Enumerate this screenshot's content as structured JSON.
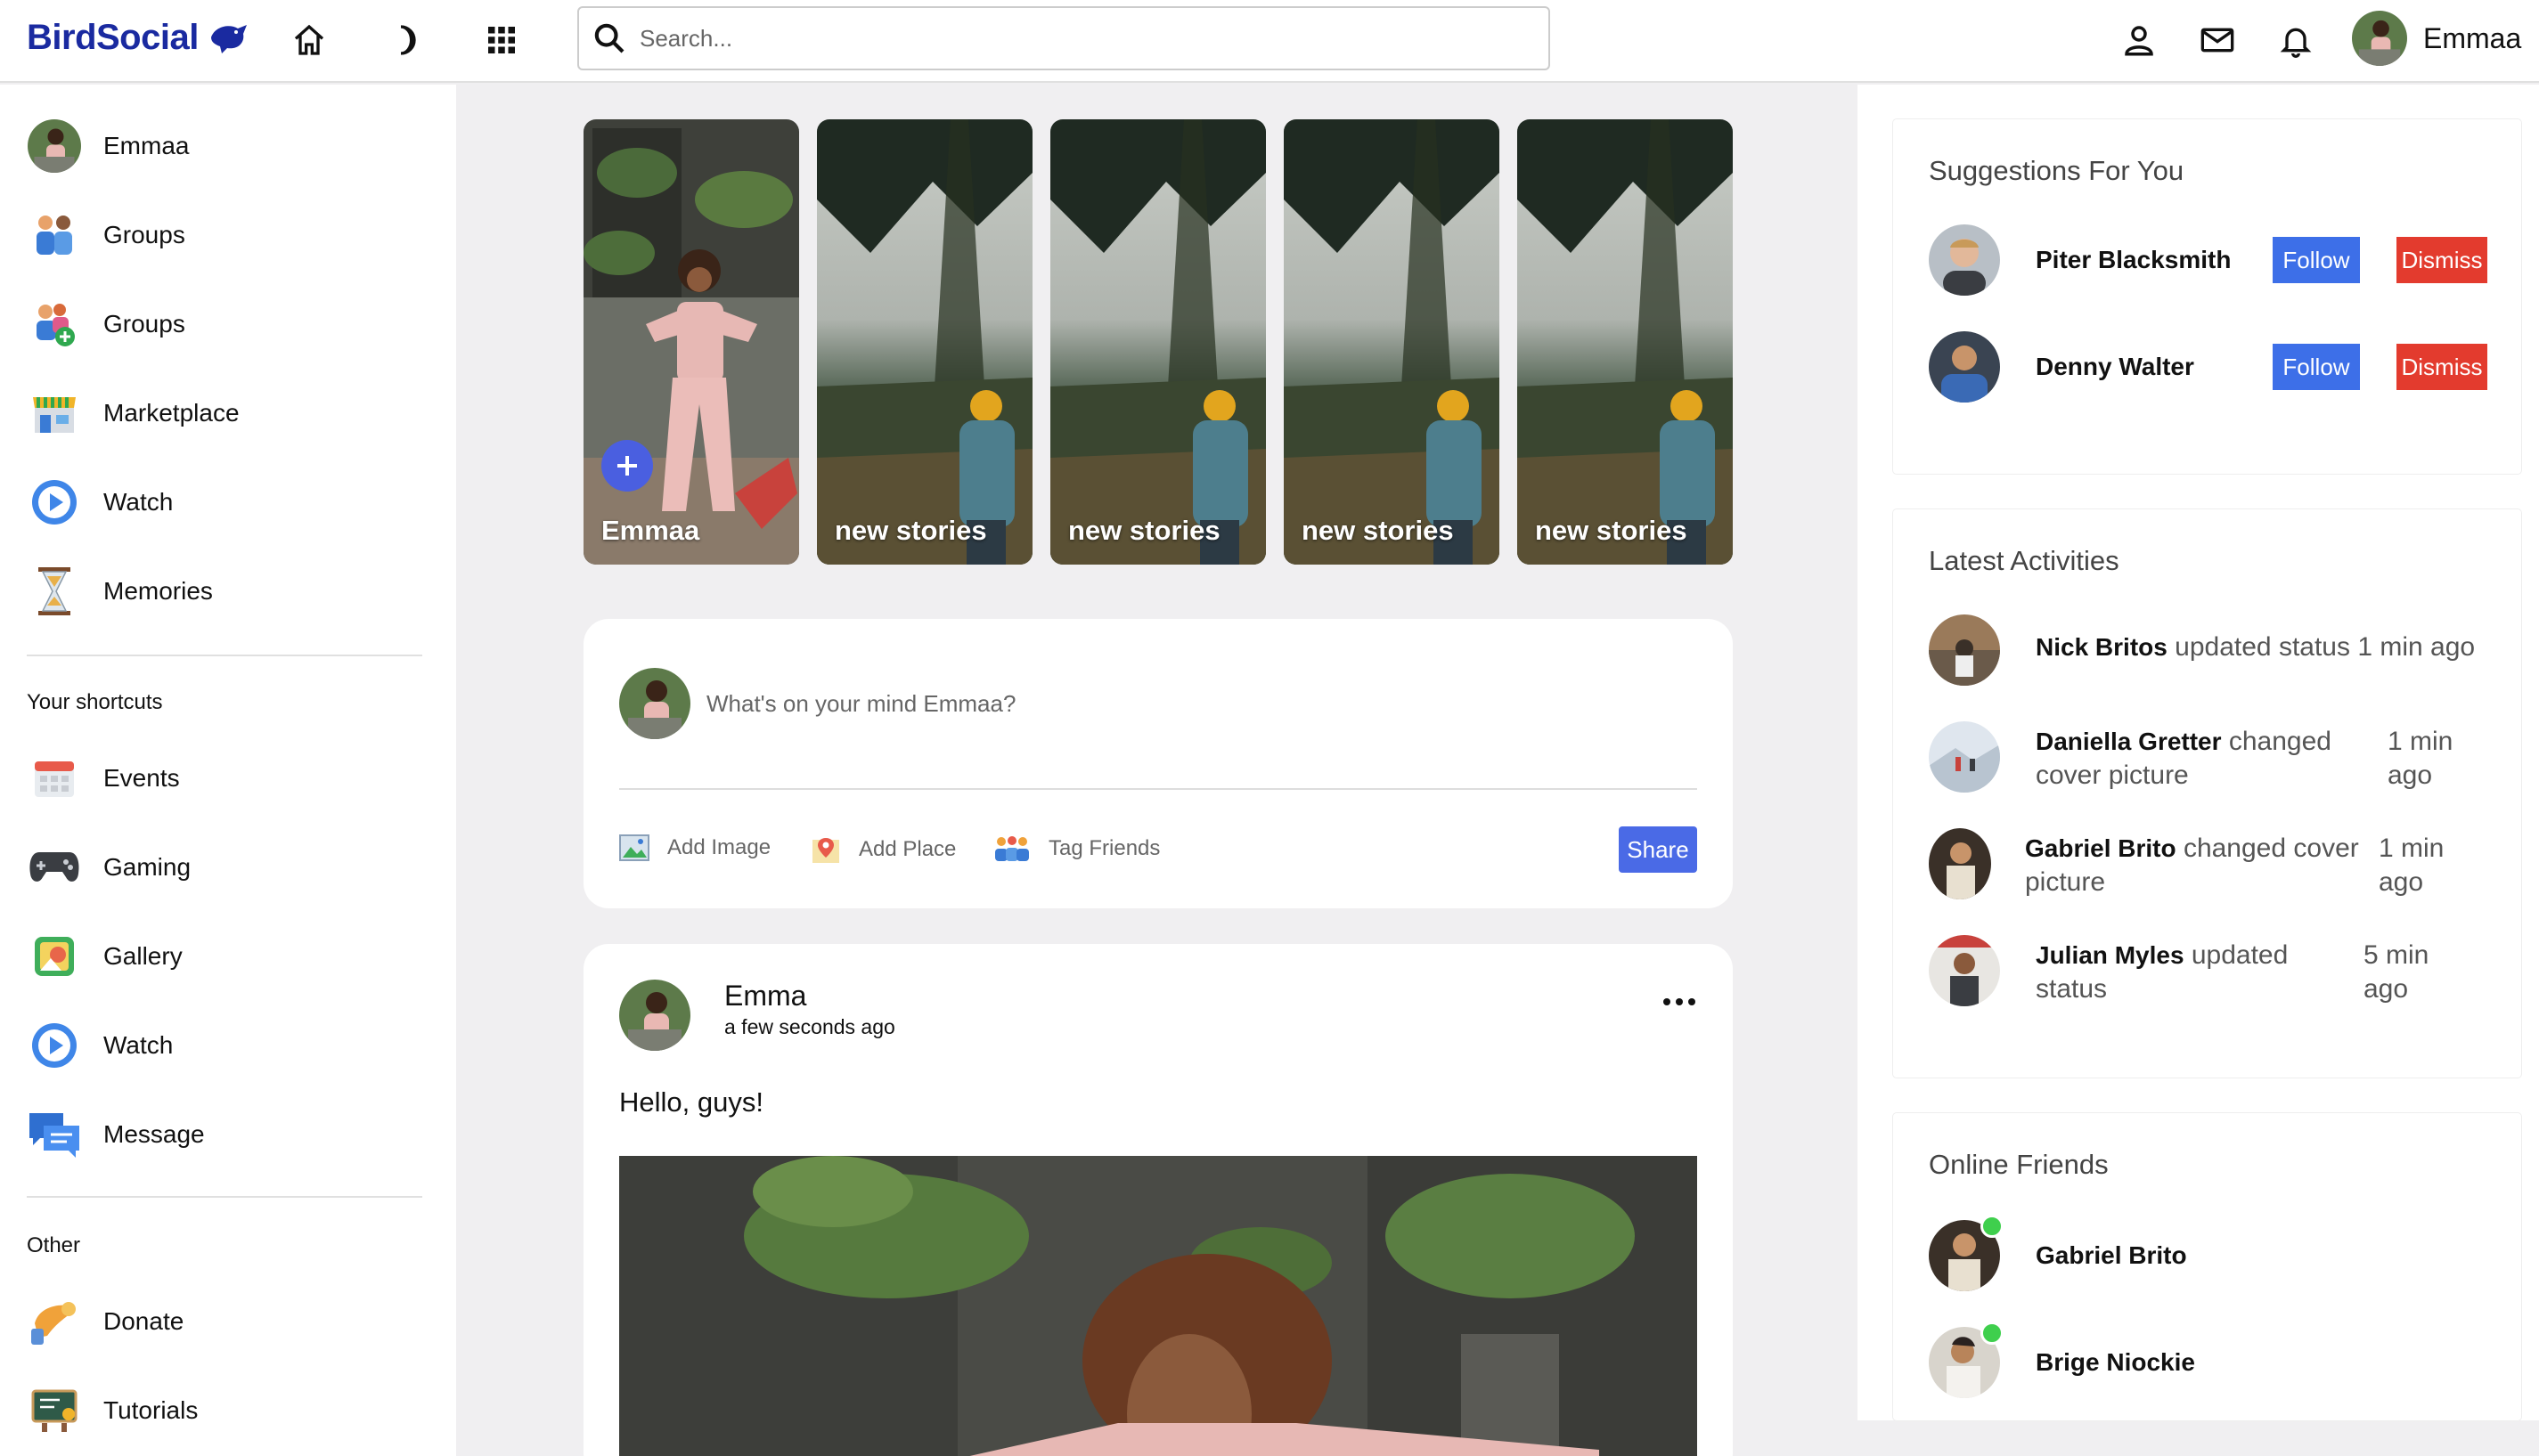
{
  "app": {
    "name": "BirdSocial"
  },
  "topbar": {
    "search_placeholder": "Search...",
    "user_name": "Emmaa"
  },
  "leftbar": {
    "items": [
      {
        "label": "Emmaa",
        "icon": "avatar"
      },
      {
        "label": "Groups",
        "icon": "friends-icon"
      },
      {
        "label": "Groups",
        "icon": "group-add-icon"
      },
      {
        "label": "Marketplace",
        "icon": "store-icon"
      },
      {
        "label": "Watch",
        "icon": "play-icon"
      },
      {
        "label": "Memories",
        "icon": "hourglass-icon"
      }
    ],
    "shortcuts_heading": "Your shortcuts",
    "shortcuts": [
      {
        "label": "Events",
        "icon": "calendar-icon"
      },
      {
        "label": "Gaming",
        "icon": "gamepad-icon"
      },
      {
        "label": "Gallery",
        "icon": "gallery-icon"
      },
      {
        "label": "Watch",
        "icon": "play-icon"
      },
      {
        "label": "Message",
        "icon": "message-icon"
      }
    ],
    "other_heading": "Other",
    "other": [
      {
        "label": "Donate",
        "icon": "donate-icon"
      },
      {
        "label": "Tutorials",
        "icon": "tutorials-icon"
      }
    ]
  },
  "stories": [
    {
      "label": "Emmaa"
    },
    {
      "label": "new stories"
    },
    {
      "label": "new stories"
    },
    {
      "label": "new stories"
    },
    {
      "label": "new stories"
    }
  ],
  "composer": {
    "prompt": "What's on your mind  Emmaa?",
    "add_image": "Add Image",
    "add_place": "Add Place",
    "tag_friends": "Tag Friends",
    "share": "Share"
  },
  "post": {
    "author": "Emma",
    "time": "a few seconds ago",
    "text": "Hello, guys!"
  },
  "suggestions": {
    "title": "Suggestions For You",
    "items": [
      {
        "name": "Piter Blacksmith",
        "follow": "Follow",
        "dismiss": "Dismiss"
      },
      {
        "name": "Denny Walter",
        "follow": "Follow",
        "dismiss": "Dismiss"
      }
    ]
  },
  "activities": {
    "title": "Latest Activities",
    "items": [
      {
        "name": "Nick Britos",
        "action": "updated status",
        "time": "1 min ago"
      },
      {
        "name": "Daniella Gretter",
        "action": "changed cover picture",
        "time": "1 min ago"
      },
      {
        "name": "Gabriel Brito",
        "action": "changed cover picture",
        "time": "1 min ago"
      },
      {
        "name": "Julian Myles",
        "action": "updated status",
        "time": "5 min ago"
      }
    ]
  },
  "online": {
    "title": "Online Friends",
    "items": [
      {
        "name": "Gabriel Brito"
      },
      {
        "name": "Brige Niockie"
      }
    ]
  },
  "colors": {
    "brand": "#1a2aa0",
    "accent": "#4a6ae6",
    "follow": "#3d6fe8",
    "dismiss": "#e33b2e",
    "online": "#3fcf4d"
  }
}
